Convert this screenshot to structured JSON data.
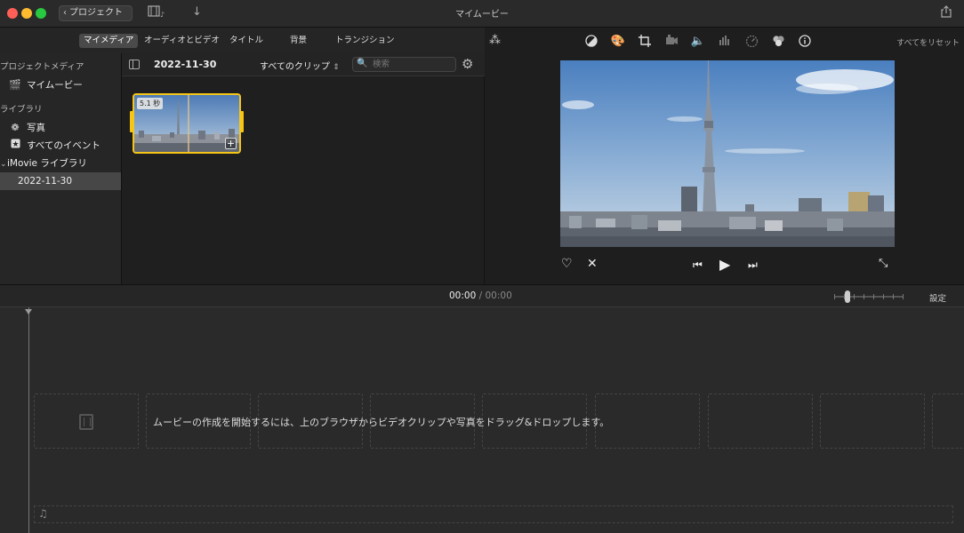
{
  "window": {
    "title": "マイムービー",
    "back_label": "プロジェクト"
  },
  "browser_tabs": [
    {
      "label": "マイメディア",
      "active": true
    },
    {
      "label": "オーディオとビデオ",
      "active": false
    },
    {
      "label": "タイトル",
      "active": false
    },
    {
      "label": "背景",
      "active": false
    },
    {
      "label": "トランジション",
      "active": false
    }
  ],
  "sidebar": {
    "project_media_header": "プロジェクトメディア",
    "project_item": "マイムービー",
    "library_header": "ライブラリ",
    "items": [
      {
        "label": "写真",
        "icon": "flower-icon"
      },
      {
        "label": "すべてのイベント",
        "icon": "star-icon"
      }
    ],
    "library_name": "iMovie ライブラリ",
    "event": "2022-11-30"
  },
  "browser": {
    "date": "2022-11-30",
    "filter": "すべてのクリップ",
    "search_placeholder": "検索",
    "clip": {
      "duration": "5.1 秒"
    }
  },
  "viewer": {
    "reset_all": "すべてをリセット"
  },
  "timeline": {
    "current": "00:00",
    "separator": "/",
    "total": "00:00",
    "settings": "設定",
    "instruction": "ムービーの作成を開始するには、上のブラウザからビデオクリップや写真をドラッグ&ドロップします。"
  },
  "colors": {
    "selection": "#f5c518",
    "sky": "#5a7ea8"
  }
}
